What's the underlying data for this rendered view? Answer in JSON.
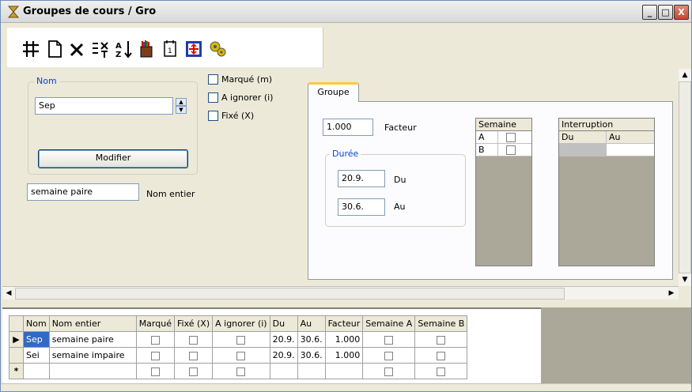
{
  "window": {
    "title": "Groupes de cours / Gro",
    "minimize": "_",
    "maximize": "□",
    "close": "X"
  },
  "toolbar": {
    "icons": [
      "grid-icon",
      "new-document-icon",
      "delete-icon",
      "sort-options-icon",
      "sort-az-icon",
      "paint-icon",
      "calendar-icon",
      "fit-icon",
      "settings-icon"
    ]
  },
  "form": {
    "nom_group_label": "Nom",
    "nom_value": "Sep",
    "modifier_label": "Modifier",
    "nom_entier_value": "semaine paire",
    "nom_entier_label": "Nom entier",
    "checks": [
      {
        "label": "Marqué (m)",
        "checked": false
      },
      {
        "label": "A ignorer (i)",
        "checked": false
      },
      {
        "label": "Fixé (X)",
        "checked": false
      }
    ]
  },
  "tab": {
    "label": "Groupe",
    "facteur_value": "1.000",
    "facteur_label": "Facteur",
    "duree_label": "Durée",
    "du_value": "20.9.",
    "du_label": "Du",
    "au_value": "30.6.",
    "au_label": "Au",
    "semaine": {
      "header": "Semaine",
      "rows": [
        "A",
        "B"
      ]
    },
    "interruption": {
      "header": "Interruption",
      "col_du": "Du",
      "col_au": "Au"
    }
  },
  "grid": {
    "columns": [
      "Nom",
      "Nom entier",
      "Marqué",
      "Fixé (X)",
      "A ignorer (i)",
      "Du",
      "Au",
      "Facteur",
      "Semaine A",
      "Semaine B"
    ],
    "rows": [
      {
        "nom": "Sep",
        "nom_entier": "semaine paire",
        "du": "20.9.",
        "au": "30.6.",
        "facteur": "1.000",
        "indicator": "▶"
      },
      {
        "nom": "Sei",
        "nom_entier": "semaine impaire",
        "du": "20.9.",
        "au": "30.6.",
        "facteur": "1.000",
        "indicator": ""
      }
    ],
    "new_row_indicator": "*"
  },
  "colors": {
    "accent": "#0046d5",
    "tab_highlight": "#ffc83c",
    "face": "#ece9d8"
  }
}
